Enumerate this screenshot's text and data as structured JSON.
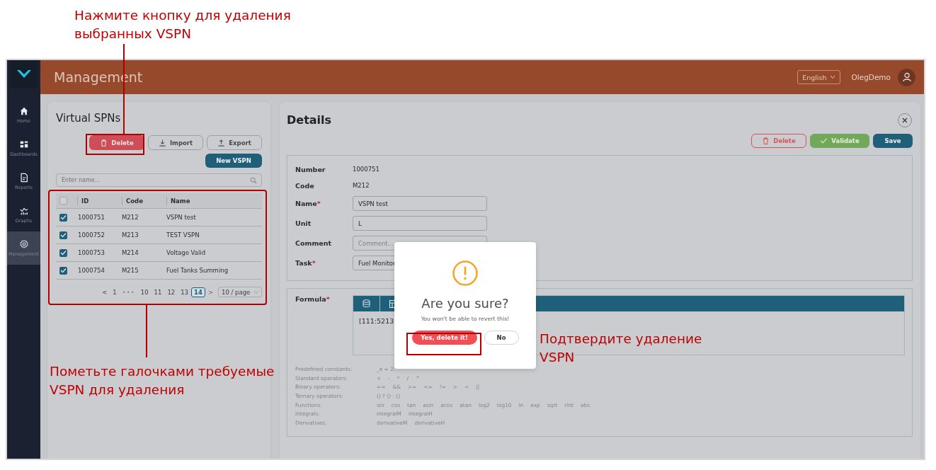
{
  "annotations": [
    {
      "text": "Нажмите кнопку для удаления\nвыбранных VSPN"
    },
    {
      "text": "Пометьте галочками требуемые\nVSPN для удаления"
    },
    {
      "text": "Подтвердите удаление\nVSPN"
    }
  ],
  "sidebar": {
    "items": [
      {
        "label": "Home",
        "selected": false
      },
      {
        "label": "Dashboards",
        "selected": false
      },
      {
        "label": "Reports",
        "selected": false
      },
      {
        "label": "Graphs",
        "selected": false
      },
      {
        "label": "Management",
        "selected": true
      }
    ]
  },
  "header": {
    "title": "Management",
    "language": "English",
    "user": "OlegDemo"
  },
  "list_panel": {
    "title": "Virtual SPNs",
    "buttons": [
      {
        "label": "Delete",
        "kind": "danger"
      },
      {
        "label": "Import",
        "kind": "outline"
      },
      {
        "label": "Export",
        "kind": "outline"
      },
      {
        "label": "New VSPN",
        "kind": "primary"
      }
    ],
    "search": {
      "placeholder": "Enter name..."
    },
    "table": {
      "header_checked": false,
      "columns": [
        "ID",
        "Code",
        "Name"
      ],
      "rows": [
        {
          "checked": true,
          "cells": [
            "1000751",
            "M212",
            "VSPN test"
          ]
        },
        {
          "checked": true,
          "cells": [
            "1000752",
            "M213",
            "TEST VSPN"
          ]
        },
        {
          "checked": true,
          "cells": [
            "1000753",
            "M214",
            "Voltage Valid"
          ]
        },
        {
          "checked": true,
          "cells": [
            "1000754",
            "M215",
            "Fuel Tanks Summing"
          ]
        }
      ]
    },
    "pagination": {
      "prev": "<",
      "next": ">",
      "pages": [
        {
          "label": "1",
          "kind": "page",
          "selected": false
        },
        {
          "label": "•••",
          "kind": "ellipsis"
        },
        {
          "label": "10",
          "kind": "page",
          "selected": false
        },
        {
          "label": "11",
          "kind": "page",
          "selected": false
        },
        {
          "label": "12",
          "kind": "page",
          "selected": false
        },
        {
          "label": "13",
          "kind": "page",
          "selected": false
        },
        {
          "label": "14",
          "kind": "page",
          "selected": true
        }
      ],
      "page_size": "10 / page"
    }
  },
  "details": {
    "title": "Details",
    "buttons": [
      {
        "label": "Delete",
        "kind": "danger-outline"
      },
      {
        "label": "Validate",
        "kind": "success"
      },
      {
        "label": "Save",
        "kind": "primary"
      }
    ],
    "fields": [
      {
        "label": "Number",
        "required": false,
        "kind": "text",
        "value": "1000751"
      },
      {
        "label": "Code",
        "required": false,
        "kind": "text",
        "value": "M212"
      },
      {
        "label": "Name",
        "required": true,
        "kind": "input",
        "value": "VSPN test"
      },
      {
        "label": "Unit",
        "required": false,
        "kind": "input",
        "value": "L"
      },
      {
        "label": "Comment",
        "required": false,
        "kind": "input",
        "placeholder": "Comment..."
      },
      {
        "label": "Task",
        "required": true,
        "kind": "input",
        "value": "Fuel Monitor"
      }
    ],
    "formula": {
      "label": "Formula",
      "required": true,
      "value": "[111:5213",
      "help": [
        {
          "label": "Predefined constants:",
          "values": [
            "_e = 2."
          ]
        },
        {
          "label": "Standard operators:",
          "values": [
            "+",
            "-",
            "*",
            "/",
            "^"
          ]
        },
        {
          "label": "Binary operators:",
          "values": [
            "==",
            "&&",
            ">=",
            "<=",
            "!=",
            ">",
            "<",
            "||"
          ]
        },
        {
          "label": "Ternary operators:",
          "values": [
            "() ? () : ()"
          ]
        },
        {
          "label": "Functions:",
          "values": [
            "sin",
            "cos",
            "tan",
            "asin",
            "acos",
            "atan",
            "log2",
            "log10",
            "ln",
            "exp",
            "sqrt",
            "rint",
            "abs"
          ]
        },
        {
          "label": "Integrals:",
          "values": [
            "integralM",
            "integralH"
          ]
        },
        {
          "label": "Derivatives:",
          "values": [
            "derivativeM",
            "derivativeH"
          ]
        }
      ]
    }
  },
  "dialog": {
    "title": "Are you sure?",
    "message": "You won't be able to revert this!",
    "confirm": "Yes, delete it!",
    "cancel": "No"
  }
}
